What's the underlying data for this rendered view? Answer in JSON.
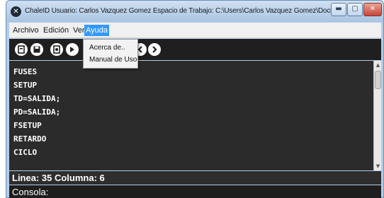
{
  "window": {
    "app_icon_glyph": "✕",
    "title": "ChaleID   Usuario: Carlos Vazquez Gomez  Espacio de Trabajo: C:\\Users\\Carlos Vazquez Gomez\\Documents\\Mapic...",
    "minimize_glyph": "▬",
    "maximize_glyph": "▢",
    "close_glyph": "✕"
  },
  "menubar": {
    "items": [
      {
        "label": "Archivo"
      },
      {
        "label": "Edición"
      },
      {
        "label": "Ver"
      },
      {
        "label": "Ayuda"
      }
    ],
    "active_index": 3
  },
  "toolbar": {
    "buttons": [
      "new-file-icon",
      "save-icon",
      "compile-icon",
      "build-icon",
      "back-icon",
      "forward-icon"
    ]
  },
  "dropdown": {
    "items": [
      {
        "label": "Acerca de.."
      },
      {
        "label": "Manual de Uso"
      }
    ]
  },
  "editor": {
    "lines": [
      "FUSES",
      "SETUP",
      "TD=SALIDA;",
      "PD=SALIDA;",
      "FSETUP",
      "RETARDO",
      "CICLO"
    ]
  },
  "status": {
    "position_text": "Linea: 35 Columna: 6"
  },
  "console": {
    "label": "Consola:"
  },
  "colors": {
    "editor_bg": "#2b2b2b",
    "menu_highlight": "#3399ff",
    "toolbar_bg": "#1f1f1f"
  }
}
